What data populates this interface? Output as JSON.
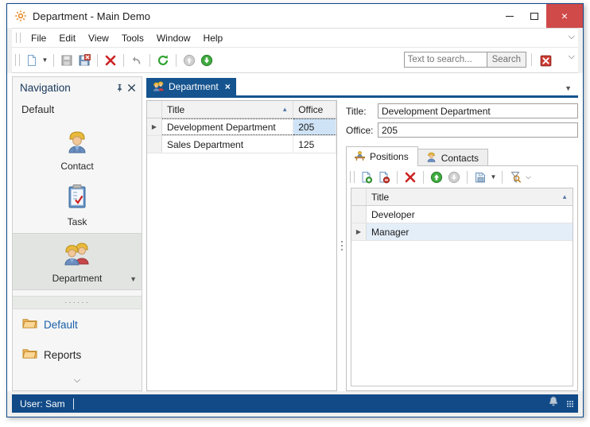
{
  "window": {
    "title": "Department - Main Demo",
    "app_icon": "gear-icon",
    "minimize_label": "",
    "maximize_label": "",
    "close_label": "×"
  },
  "menubar": {
    "items": [
      {
        "label": "File"
      },
      {
        "label": "Edit"
      },
      {
        "label": "View"
      },
      {
        "label": "Tools"
      },
      {
        "label": "Window"
      },
      {
        "label": "Help"
      }
    ],
    "overflow_icon": "chevron-down-icon"
  },
  "toolbar": {
    "buttons": [
      {
        "name": "new-icon",
        "title": "New"
      },
      {
        "name": "new-dropdown-caret-icon",
        "title": "New options"
      },
      {
        "name": "save-icon",
        "title": "Save"
      },
      {
        "name": "save-and-close-icon",
        "title": "Save and Close"
      },
      {
        "name": "delete-icon",
        "title": "Delete"
      },
      {
        "name": "undo-icon",
        "title": "Undo"
      },
      {
        "name": "refresh-icon",
        "title": "Refresh"
      },
      {
        "name": "move-up-icon",
        "title": "Previous Object"
      },
      {
        "name": "move-down-icon",
        "title": "Next Object"
      }
    ],
    "search": {
      "placeholder": "Text to search...",
      "value": "",
      "button_label": "Search",
      "clear_icon": "clear-search-icon"
    },
    "overflow_icon": "chevron-down-icon"
  },
  "navigation": {
    "title": "Navigation",
    "pin_icon": "pin-icon",
    "close_icon": "close-icon",
    "group_label": "Default",
    "items": [
      {
        "label": "Contact",
        "icon": "contact-person-icon",
        "selected": false
      },
      {
        "label": "Task",
        "icon": "task-clipboard-icon",
        "selected": false
      },
      {
        "label": "Department",
        "icon": "department-people-icon",
        "selected": true
      }
    ],
    "splitter_dots": "······",
    "links": [
      {
        "label": "Default",
        "icon": "folder-icon",
        "accent": true
      },
      {
        "label": "Reports",
        "icon": "folder-icon",
        "accent": false
      }
    ],
    "expand_icon": "chevron-down-icon"
  },
  "document_tabs": {
    "tabs": [
      {
        "label": "Department",
        "icon": "department-people-icon",
        "close_label": "×",
        "active": true
      }
    ],
    "overflow_icon": "caret-down-icon"
  },
  "master_grid": {
    "columns": [
      {
        "label": "Title",
        "width": 166,
        "sorted": "asc",
        "sort_glyph": "▲"
      },
      {
        "label": "Office",
        "width": 54,
        "sorted": "",
        "sort_glyph": ""
      }
    ],
    "rows": [
      {
        "indicator": "▶",
        "focused": true,
        "cells": [
          "Development Department",
          "205"
        ],
        "active_cell_index": 1
      },
      {
        "indicator": "",
        "focused": false,
        "cells": [
          "Sales Department",
          "125"
        ],
        "active_cell_index": -1
      }
    ]
  },
  "detail": {
    "fields": [
      {
        "label": "Title:",
        "value": "Development Department",
        "placeholder": ""
      },
      {
        "label": "Office:",
        "value": "205",
        "placeholder": ""
      }
    ],
    "tabs": [
      {
        "label": "Positions",
        "icon": "positions-desk-icon",
        "active": true
      },
      {
        "label": "Contacts",
        "icon": "contact-person-icon",
        "active": false
      }
    ],
    "toolbar": [
      {
        "name": "new-record-icon",
        "title": "New"
      },
      {
        "name": "remove-record-icon",
        "title": "Remove"
      },
      {
        "name": "delete-icon",
        "title": "Delete"
      },
      {
        "name": "move-up-icon",
        "title": "Move Up"
      },
      {
        "name": "move-down-icon",
        "title": "Move Down"
      },
      {
        "name": "export-icon",
        "title": "Export"
      },
      {
        "name": "export-dropdown-caret-icon",
        "title": "Export options"
      },
      {
        "name": "filter-icon",
        "title": "Filter"
      },
      {
        "name": "overflow-chevron-icon",
        "title": "More"
      }
    ],
    "grid": {
      "columns": [
        {
          "label": "Title",
          "sorted": "asc",
          "sort_glyph": "▲"
        }
      ],
      "rows": [
        {
          "indicator": "",
          "selected": false,
          "cells": [
            "Developer"
          ]
        },
        {
          "indicator": "▶",
          "selected": true,
          "cells": [
            "Manager"
          ]
        }
      ]
    }
  },
  "statusbar": {
    "user_text": "User: Sam",
    "notification_icon": "bell-icon",
    "resize_grip_icon": "resize-grip-icon"
  },
  "colors": {
    "accent_blue": "#15548f",
    "status_blue": "#114a87",
    "close_red": "#d04a4a",
    "selection_blue": "#cfe3f6",
    "nav_title_blue": "#17365d",
    "link_blue": "#1a5fa8"
  }
}
